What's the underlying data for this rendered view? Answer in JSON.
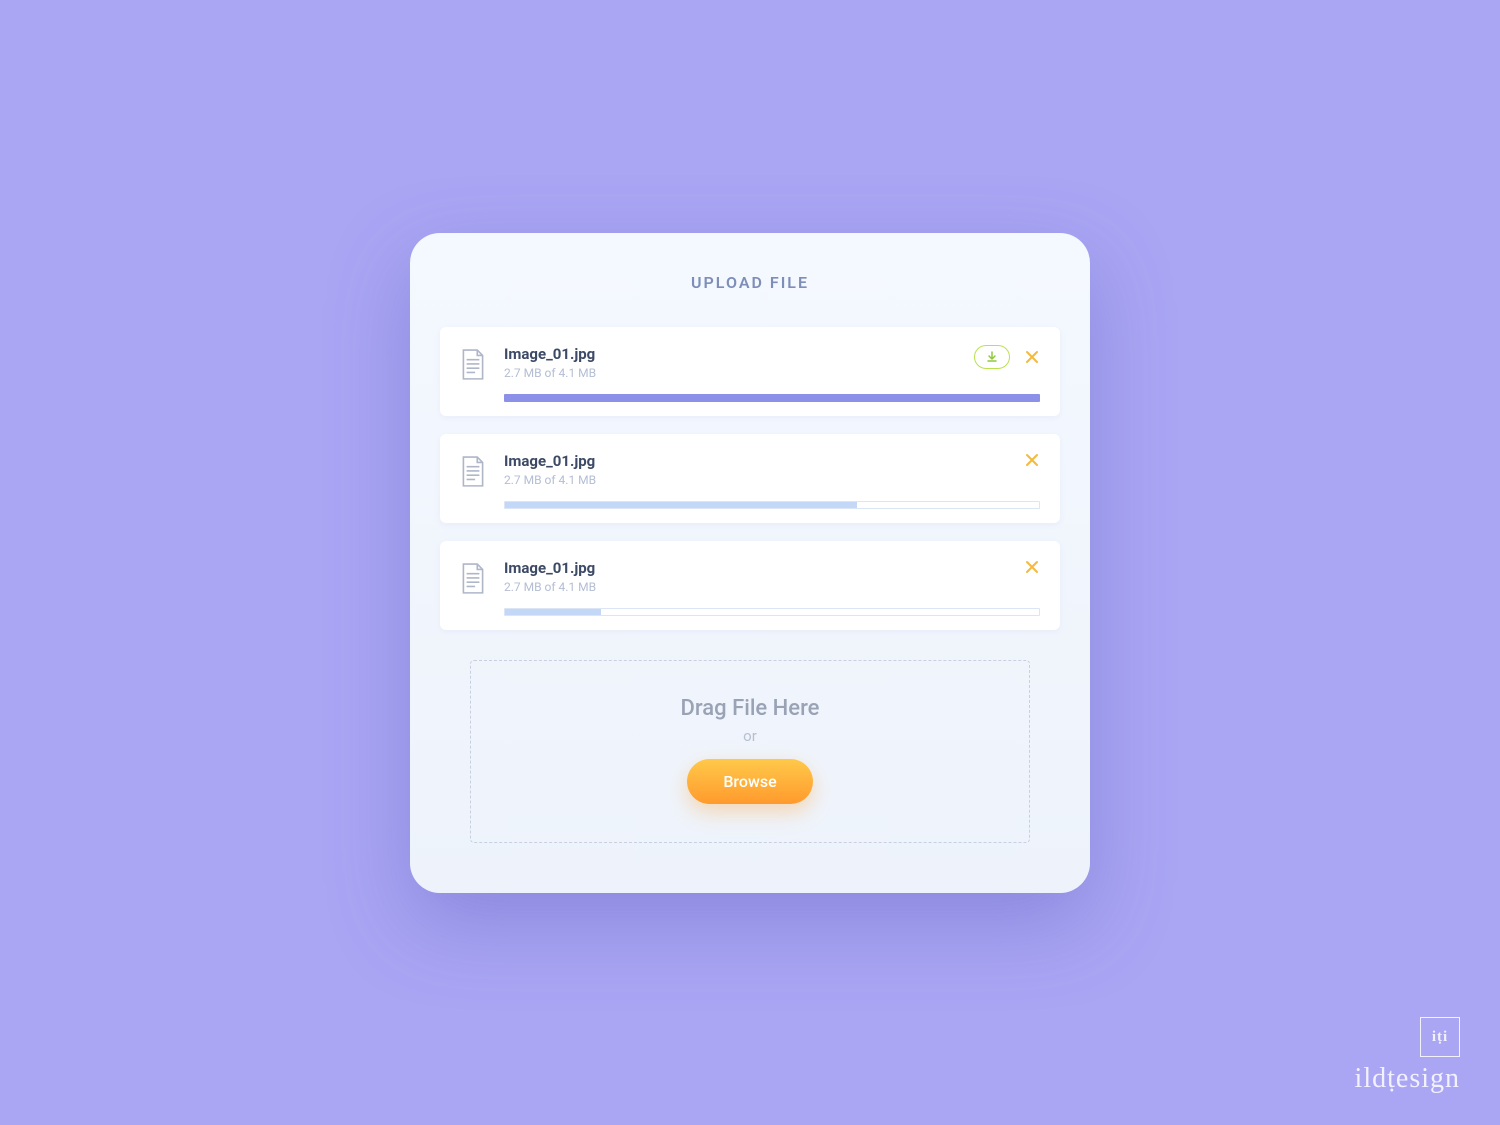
{
  "title": "UPLOAD FILE",
  "files": [
    {
      "name": "Image_01.jpg",
      "size": "2.7 MB of 4.1 MB",
      "progress": 100,
      "complete": true
    },
    {
      "name": "Image_01.jpg",
      "size": "2.7 MB of 4.1 MB",
      "progress": 66,
      "complete": false
    },
    {
      "name": "Image_01.jpg",
      "size": "2.7 MB of 4.1 MB",
      "progress": 18,
      "complete": false
    }
  ],
  "dropzone": {
    "drag_label": "Drag File Here",
    "or_label": "or",
    "browse_label": "Browse"
  },
  "watermark": {
    "logo": "iṭi",
    "brand": "ildṭesign"
  },
  "colors": {
    "bg": "#aaa6f4",
    "card": "#f4f8ff",
    "accent_done": "#8c90e6",
    "accent_partial": "#c3d7f7",
    "browse_top": "#ffc94a",
    "browse_bottom": "#ff9a2d",
    "close": "#f5b93c",
    "download": "#8fc93a"
  }
}
